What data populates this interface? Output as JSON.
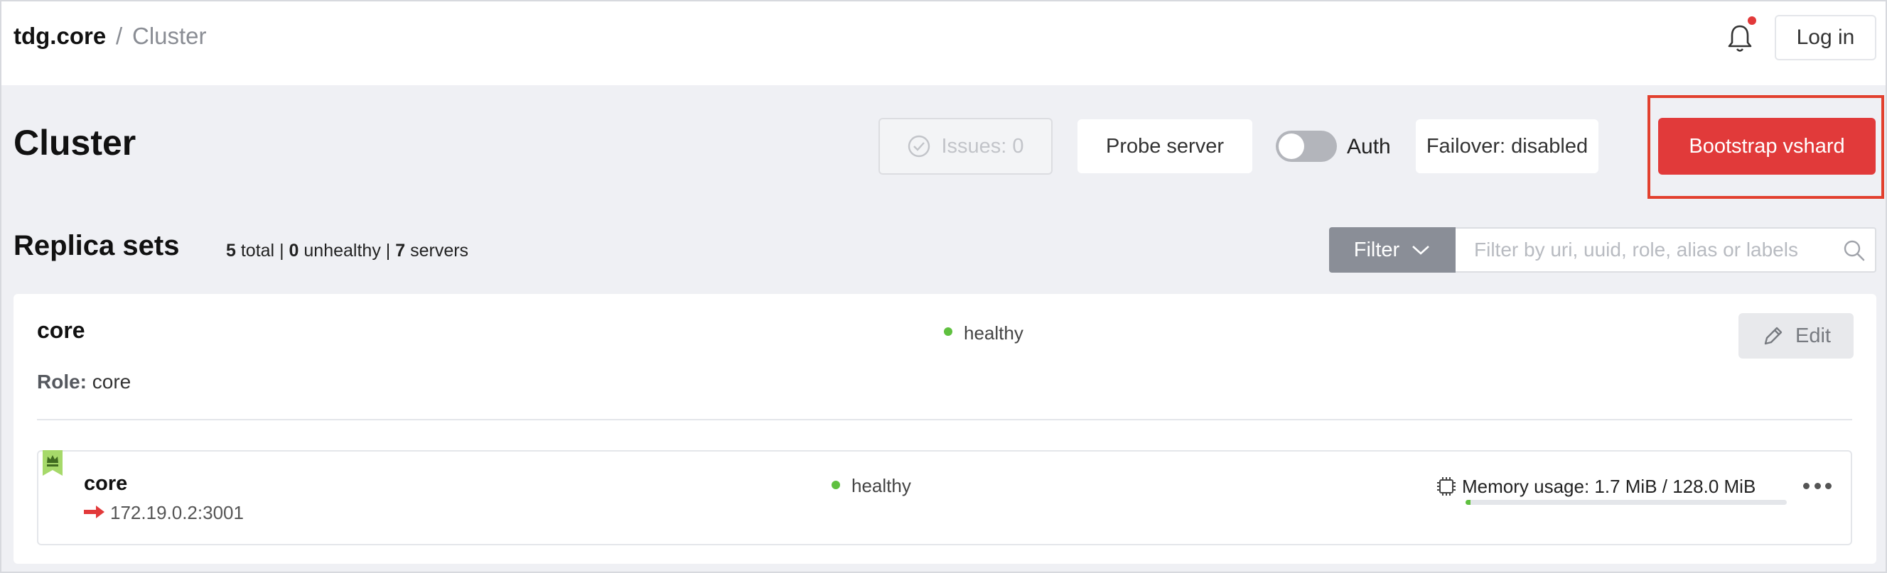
{
  "header": {
    "app_name": "tdg.core",
    "separator": "/",
    "current_page": "Cluster",
    "login_label": "Log in"
  },
  "toolbar": {
    "title": "Cluster",
    "issues_label": "Issues: 0",
    "probe_label": "Probe server",
    "auth_label": "Auth",
    "auth_enabled": false,
    "failover_label": "Failover: disabled",
    "bootstrap_label": "Bootstrap vshard"
  },
  "replica_sets": {
    "title": "Replica sets",
    "total_count": "5",
    "total_label": "total",
    "unhealthy_count": "0",
    "unhealthy_label": "unhealthy",
    "servers_count": "7",
    "servers_label": "servers",
    "filter_label": "Filter",
    "filter_placeholder": "Filter by uri, uuid, role, alias or labels",
    "items": [
      {
        "name": "core",
        "status": "healthy",
        "edit_label": "Edit",
        "role_label": "Role:",
        "role_value": "core",
        "servers": [
          {
            "alias": "core",
            "uri": "172.19.0.2:3001",
            "status": "healthy",
            "memory_label": "Memory usage: 1.7 MiB / 128.0 MiB",
            "memory_fraction": 0.013
          }
        ]
      }
    ]
  },
  "colors": {
    "accent": "#e13a3a",
    "healthy": "#5fc03f",
    "leader_badge": "#a6d96a"
  },
  "icons": [
    "bell-icon",
    "check-circle-icon",
    "chevron-down-icon",
    "search-icon",
    "pencil-icon",
    "crown-icon",
    "arrow-right-icon",
    "chip-icon",
    "more-icon"
  ]
}
